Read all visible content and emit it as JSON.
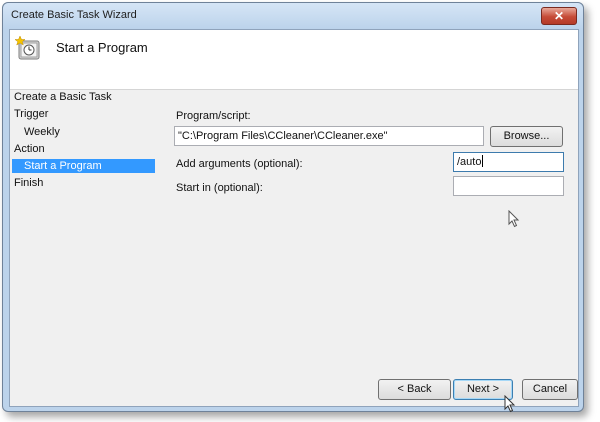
{
  "window": {
    "title": "Create Basic Task Wizard",
    "close_label": "✕"
  },
  "header": {
    "title": "Start a Program",
    "icon": "task-scheduler-clock-icon"
  },
  "sidebar": {
    "items": [
      {
        "label": "Create a Basic Task",
        "selected": false
      },
      {
        "label": "Trigger",
        "selected": false
      },
      {
        "label": "Weekly",
        "selected": false
      },
      {
        "label": "Action",
        "selected": false
      },
      {
        "label": "Start a Program",
        "selected": true
      },
      {
        "label": "Finish",
        "selected": false
      }
    ]
  },
  "form": {
    "program_label": "Program/script:",
    "program_value": "\"C:\\Program Files\\CCleaner\\CCleaner.exe\"",
    "browse_label": "Browse...",
    "arguments_label": "Add arguments (optional):",
    "arguments_value": "/auto",
    "start_in_label": "Start in (optional):",
    "start_in_value": ""
  },
  "buttons": {
    "back": "< Back",
    "next": "Next >",
    "cancel": "Cancel"
  },
  "colors": {
    "selection": "#3399ff",
    "frame": "#bcd3eb",
    "close": "#c64b37"
  }
}
